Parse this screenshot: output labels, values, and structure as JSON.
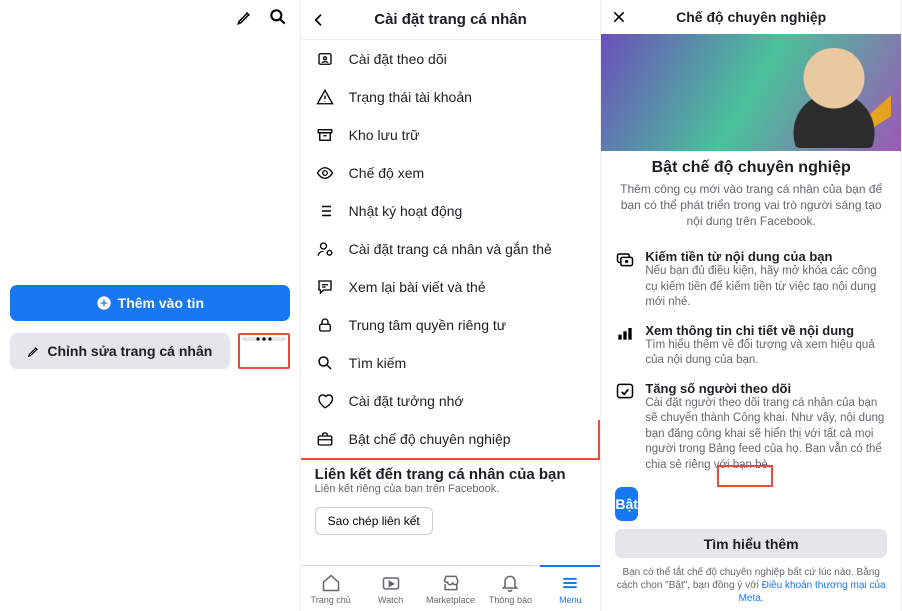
{
  "panel1": {
    "add_story": "Thêm vào tin",
    "edit_profile": "Chỉnh sửa trang cá nhân"
  },
  "panel2": {
    "title": "Cài đặt trang cá nhân",
    "items": [
      "Cài đặt theo dõi",
      "Trạng thái tài khoản",
      "Kho lưu trữ",
      "Chế độ xem",
      "Nhật ký hoạt động",
      "Cài đặt trang cá nhân và gắn thẻ",
      "Xem lại bài viết và thẻ",
      "Trung tâm quyền riêng tư",
      "Tìm kiếm",
      "Cài đặt tưởng nhớ",
      "Bật chế độ chuyên nghiệp"
    ],
    "link_section_title": "Liên kết đến trang cá nhân của bạn",
    "link_section_sub": "Liên kết riêng của bạn trên Facebook.",
    "copy_link": "Sao chép liên kết",
    "tabs": [
      "Trang chủ",
      "Watch",
      "Marketplace",
      "Thông báo",
      "Menu"
    ]
  },
  "panel3": {
    "title": "Chế độ chuyên nghiệp",
    "heading": "Bật chế độ chuyên nghiệp",
    "subheading": "Thêm công cụ mới vào trang cá nhân của bạn để bạn có thể phát triển trong vai trò người sáng tạo nội dung trên Facebook.",
    "features": [
      {
        "title": "Kiếm tiền từ nội dung của bạn",
        "desc": "Nếu bạn đủ điều kiện, hãy mở khóa các công cụ kiếm tiền để kiếm tiền từ việc tạo nội dung mới nhé."
      },
      {
        "title": "Xem thông tin chi tiết về nội dung",
        "desc": "Tìm hiểu thêm về đối tượng và xem hiệu quả của nội dung của bạn."
      },
      {
        "title": "Tăng số người theo dõi",
        "desc": "Cài đặt người theo dõi trang cá nhân của bạn sẽ chuyển thành Công khai. Như vậy, nội dung bạn đăng công khai sẽ hiển thị với tất cả mọi người trong Bảng feed của họ. Bạn vẫn có thể chia sẻ riêng với bạn bè."
      }
    ],
    "turn_on": "Bật",
    "learn_more": "Tìm hiểu thêm",
    "terms_prefix": "Bạn có thể tắt chế độ chuyên nghiệp bất cứ lúc nào. Bằng cách chọn \"Bật\", bạn đồng ý với ",
    "terms_link": "Điều khoản thương mại của Meta",
    "terms_suffix": "."
  }
}
